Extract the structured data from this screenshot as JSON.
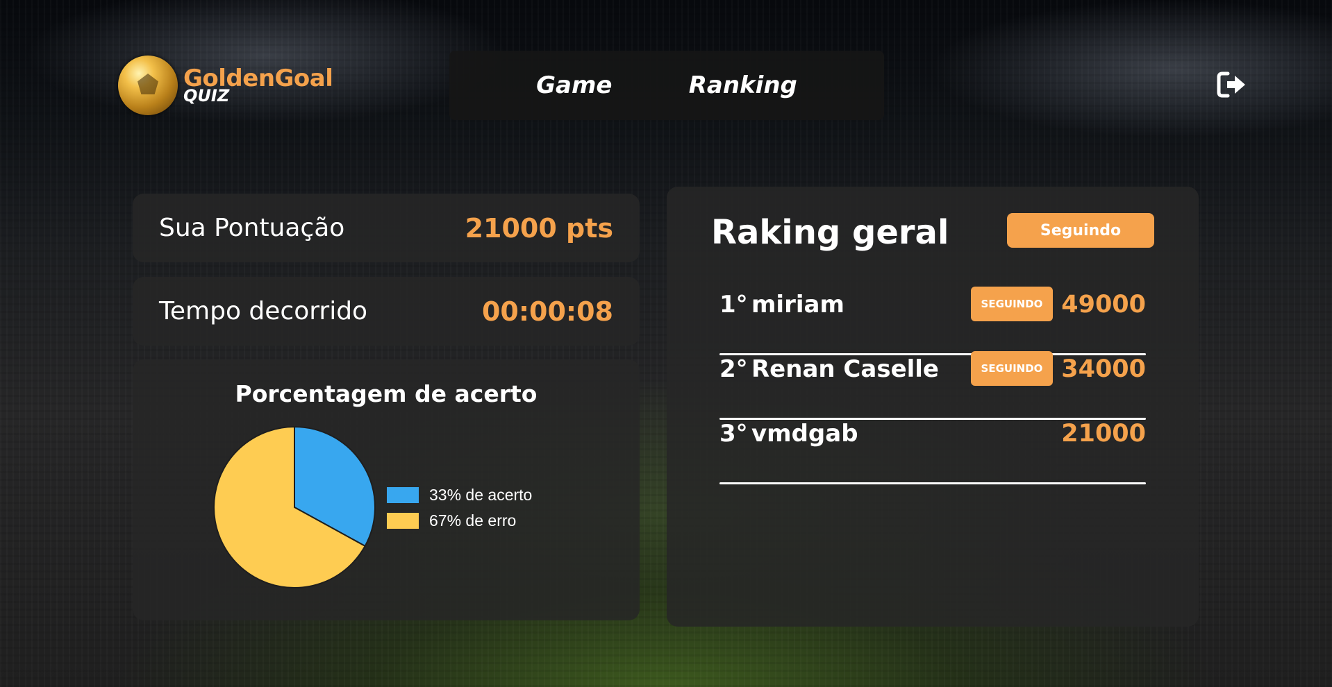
{
  "brand": {
    "title": "GoldenGoal",
    "subtitle": "QUIZ"
  },
  "nav": {
    "items": [
      {
        "label": "Game"
      },
      {
        "label": "Ranking"
      }
    ],
    "logout_icon": "sign-out-icon"
  },
  "stats": {
    "score_label": "Sua Pontuação",
    "score_value": "21000 pts",
    "time_label": "Tempo decorrido",
    "time_value": "00:00:08"
  },
  "colors": {
    "accent": "#f5a24c",
    "correct": "#38a7ef",
    "wrong": "#fecc52",
    "card": "#262626"
  },
  "chart_data": {
    "type": "pie",
    "title": "Porcentagem de acerto",
    "categories": [
      "33% de acerto",
      "67% de erro"
    ],
    "values": [
      33,
      67
    ],
    "colors": [
      "#38a7ef",
      "#fecc52"
    ],
    "legend": "right"
  },
  "ranking": {
    "title": "Raking geral",
    "follow_label": "Seguindo",
    "rows": [
      {
        "position": "1°",
        "name": "miriam",
        "follow": "SEGUINDO",
        "score": "49000"
      },
      {
        "position": "2°",
        "name": "Renan Caselle",
        "follow": "SEGUINDO",
        "score": "34000"
      },
      {
        "position": "3°",
        "name": "vmdgab",
        "follow": "",
        "score": "21000"
      }
    ]
  }
}
